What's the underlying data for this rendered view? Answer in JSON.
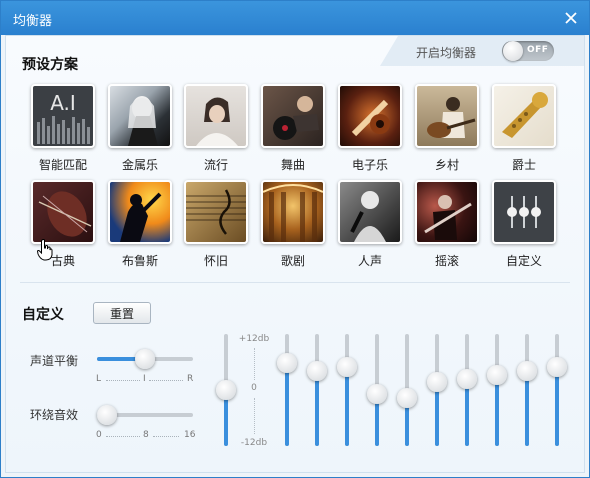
{
  "window": {
    "title": "均衡器",
    "accent": "#2a80cf"
  },
  "switch": {
    "label": "开启均衡器",
    "state": "OFF"
  },
  "presets": {
    "title": "预设方案",
    "items": [
      {
        "label": "智能匹配",
        "icon": "ai-icon"
      },
      {
        "label": "金属乐",
        "icon": "metal-photo"
      },
      {
        "label": "流行",
        "icon": "pop-photo"
      },
      {
        "label": "舞曲",
        "icon": "dance-photo"
      },
      {
        "label": "电子乐",
        "icon": "electronic-photo"
      },
      {
        "label": "乡村",
        "icon": "country-photo"
      },
      {
        "label": "爵士",
        "icon": "jazz-photo"
      },
      {
        "label": "古典",
        "icon": "classical-photo"
      },
      {
        "label": "布鲁斯",
        "icon": "blues-photo"
      },
      {
        "label": "怀旧",
        "icon": "nostalgia-photo"
      },
      {
        "label": "歌剧",
        "icon": "opera-photo"
      },
      {
        "label": "人声",
        "icon": "vocal-photo"
      },
      {
        "label": "摇滚",
        "icon": "rock-photo"
      },
      {
        "label": "自定义",
        "icon": "custom-sliders-icon"
      }
    ]
  },
  "custom": {
    "title": "自定义",
    "reset_label": "重置",
    "balance": {
      "label": "声道平衡",
      "left": "L",
      "mid": "I",
      "right": "R",
      "value": 0.5
    },
    "surround": {
      "label": "环绕音效",
      "min": "0",
      "mid": "8",
      "max": "16",
      "value": 0
    }
  },
  "eq": {
    "top_label": "+12db",
    "zero_label": "0",
    "bottom_label": "-12db",
    "preamp_db": 0,
    "bands_db": [
      7,
      5,
      6,
      -1,
      -2,
      2,
      3,
      4,
      5,
      6
    ]
  }
}
